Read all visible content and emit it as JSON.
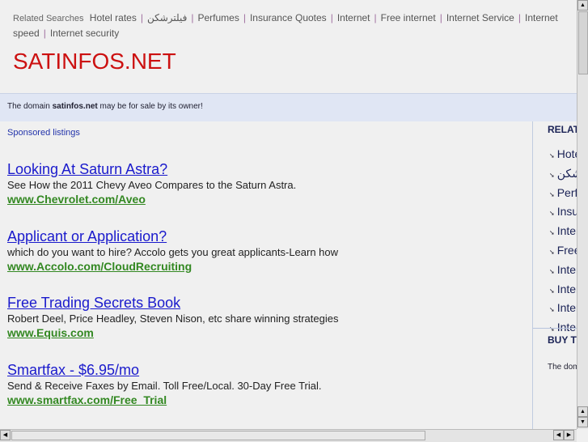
{
  "related_searches": {
    "label": "Related Searches",
    "items": [
      "Hotel rates",
      "فیلترشکن",
      "Perfumes",
      "Insurance Quotes",
      "Internet",
      "Free internet",
      "Internet Service",
      "Internet speed",
      "Internet security"
    ]
  },
  "logo": "SATINFOS.NET",
  "sale_bar": {
    "prefix": "The domain ",
    "domain": "satinfos.net",
    "suffix": " may be for sale by its owner!"
  },
  "sponsored_label": "Sponsored listings",
  "ads": [
    {
      "title": "Looking At Saturn Astra?",
      "desc": "See How the 2011 Chevy Aveo Compares to the Saturn Astra.",
      "url": "www.Chevrolet.com/Aveo"
    },
    {
      "title": "Applicant or Application?",
      "desc": "which do you want to hire? Accolo gets you great applicants-Learn how",
      "url": "www.Accolo.com/CloudRecruiting"
    },
    {
      "title": "Free Trading Secrets Book",
      "desc": "Robert Deel, Price Headley, Steven Nison, etc share winning strategies",
      "url": "www.Equis.com"
    },
    {
      "title": "Smartfax - $6.95/mo",
      "desc": "Send & Receive Faxes by Email. Toll Free/Local. 30-Day Free Trial.",
      "url": "www.smartfax.com/Free_Trial"
    }
  ],
  "sidebar": {
    "related_title": "RELATED SEARCHES",
    "items": [
      "Hotel rates",
      "فیلترشکن",
      "Perfumes",
      "Insurance Quotes",
      "Internet",
      "Free internet",
      "Internet Service",
      "Internet speed",
      "Internet security",
      "Internet"
    ],
    "buy_title": "BUY THIS DOMAIN",
    "buy_text": "The domain satinfos.net may be for sale by its owner!"
  }
}
